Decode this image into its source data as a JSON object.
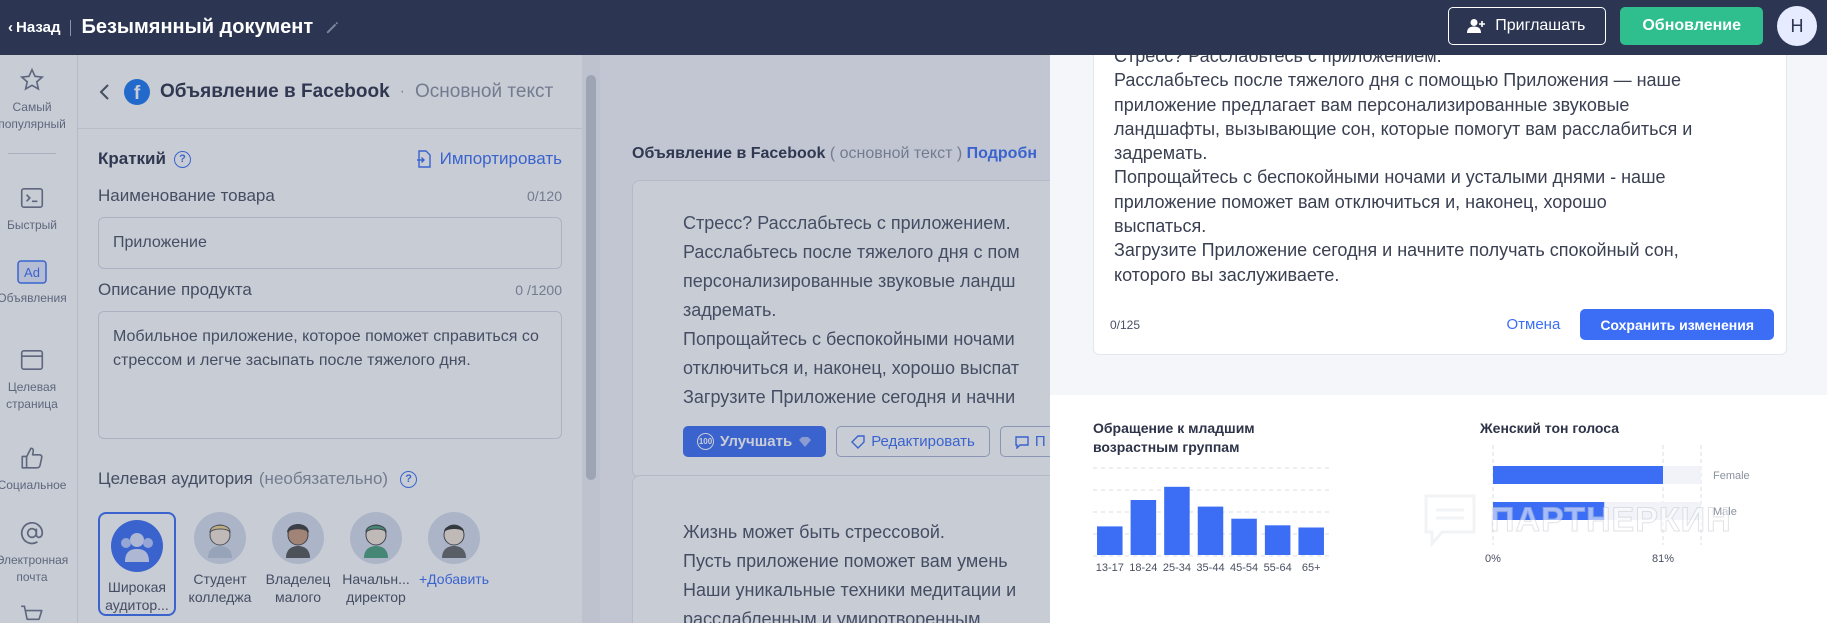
{
  "topbar": {
    "back_label": "Назад",
    "document_title": "Безымянный документ",
    "invite_label": "Приглашать",
    "update_label": "Обновление",
    "avatar_letter": "Н"
  },
  "rail": {
    "items": [
      {
        "label": "Самый популярный",
        "icon": "star-icon"
      },
      {
        "label": "Быстрый",
        "icon": "terminal-icon"
      },
      {
        "label": "Объявления",
        "icon": "ad-icon"
      },
      {
        "label": "Целевая страница",
        "icon": "landing-page-icon"
      },
      {
        "label": "Социальное",
        "icon": "thumbs-up-icon"
      },
      {
        "label": "Электронная почта",
        "icon": "at-icon"
      }
    ]
  },
  "panel": {
    "title": "Объявление в Facebook",
    "subtitle": "Основной текст",
    "section_label": "Краткий",
    "import_label": "Импортировать",
    "product_name_label": "Наименование товара",
    "product_name_counter": "0/120",
    "product_name_value": "Приложение",
    "product_desc_label": "Описание продукта",
    "product_desc_counter": "0 /1200",
    "product_desc_value": "Мобильное приложение, которое поможет справиться со стрессом и легче засыпать после тяжелого дня.",
    "audience_label": "Целевая аудитория",
    "audience_optional": "(необязательно)",
    "audiences": [
      {
        "label": "Широкая аудитор..."
      },
      {
        "label": "Студент колледжа"
      },
      {
        "label": "Владелец малого"
      },
      {
        "label": "Начальн... директор"
      }
    ],
    "add_label": "+Добавить"
  },
  "middle": {
    "heading_title": "Объявление в Facebook",
    "heading_muted": "( основной текст )",
    "heading_link": "Подробн",
    "card1_lines": [
      "Стресс? Расслабьтесь с приложением.",
      "Расслабьтесь после тяжелого дня с пом",
      "персонализированные звуковые ландш",
      "задремать.",
      "Попрощайтесь с беспокойными ночами",
      "отключиться и, наконец, хорошо выспат",
      "Загрузите Приложение сегодня и начни"
    ],
    "improve_label": "Улучшать",
    "improve_badge": "100",
    "edit_label": "Редактировать",
    "more_label": "П",
    "card2_lines": [
      "Жизнь может быть стрессовой.",
      "Пусть приложение поможет вам умень",
      "Наши уникальные техники медитации и",
      "расслабленным и умиротворенным"
    ]
  },
  "editor": {
    "lines": [
      "Стресс? Расслабьтесь с приложением.",
      "Расслабьтесь после тяжелого дня с помощью Приложения — наше",
      "приложение предлагает вам персонализированные звуковые",
      "ландшафты, вызывающие сон, которые помогут вам расслабиться и",
      "задремать.",
      "Попрощайтесь с беспокойными ночами и усталыми днями - наше",
      "приложение поможет вам отключиться и, наконец, хорошо",
      "выспаться.",
      "Загрузите Приложение сегодня и начните получать спокойный сон,",
      "которого вы заслуживаете."
    ],
    "counter": "0/125",
    "cancel_label": "Отмена",
    "save_label": "Сохранить изменения"
  },
  "stats": {
    "age_title": "Обращение к младшим возрастным группам",
    "voice_title": "Женский тон голоса"
  },
  "chart_data": [
    {
      "type": "bar",
      "title": "Обращение к младшим возрастным группам",
      "categories": [
        "13-17",
        "18-24",
        "25-34",
        "35-44",
        "45-54",
        "55-64",
        "65+"
      ],
      "values": [
        26,
        50,
        62,
        44,
        33,
        27,
        25
      ],
      "ylim": [
        0,
        80
      ],
      "grid": true,
      "colors": [
        "#3b6ef5"
      ]
    },
    {
      "type": "bar",
      "orientation": "horizontal",
      "title": "Женский тон голоса",
      "categories": [
        "Female",
        "Male"
      ],
      "values": [
        81,
        53
      ],
      "xticks": [
        "0%",
        "81%"
      ],
      "colors": [
        "#3b6ef5"
      ]
    }
  ],
  "watermark": "ПАРТНЕРКИН",
  "colors": {
    "topbar": "#2c3652",
    "accent": "#3b6ef5",
    "update": "#2fbf8e"
  }
}
